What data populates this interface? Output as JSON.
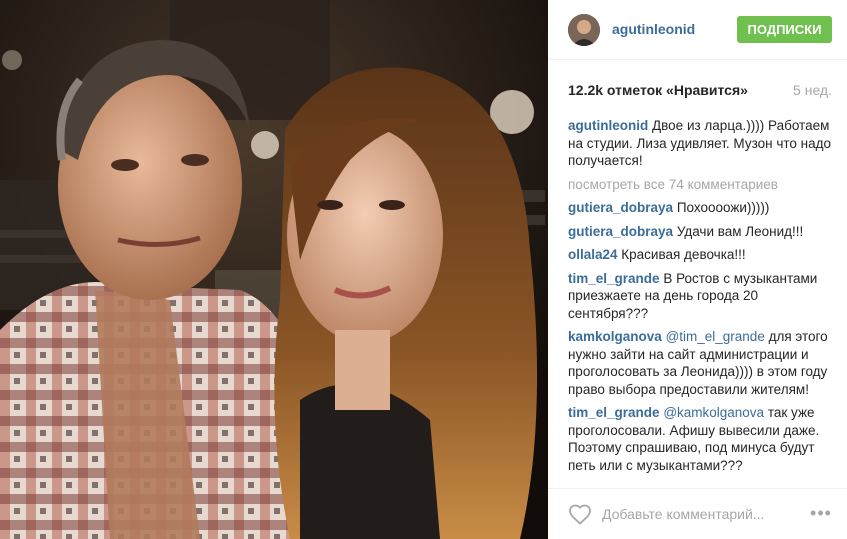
{
  "post": {
    "photo_alt": "Selfie of two people in a recording studio",
    "header": {
      "username": "agutinleonid",
      "follow_label": "ПОДПИСКИ"
    },
    "likes": "12.2k отметок «Нравится»",
    "time_ago": "5 нед.",
    "caption": {
      "user": "agutinleonid",
      "text": "Двое из ларца.)))) Работаем на студии. Лиза удивляет. Музон что надо получается!"
    },
    "view_all": "посмотреть все 74 комментариев",
    "comments": [
      {
        "user": "gutiera_dobraya",
        "text": "Похоооожи)))))"
      },
      {
        "user": "gutiera_dobraya",
        "text": "Удачи вам Леонид!!!"
      },
      {
        "user": "ollala24",
        "text": "Красивая девочка!!!"
      },
      {
        "user": "tim_el_grande",
        "text": "В Ростов с музыкантами приезжаете на день города 20 сентября???"
      },
      {
        "user": "kamkolganova",
        "mention": "@tim_el_grande",
        "text": "для этого нужно зайти на сайт администрации и проголосовать за Леонида)))) в этом году право выбора предоставили жителям!"
      },
      {
        "user": "tim_el_grande",
        "mention": "@kamkolganova",
        "text": "так уже проголосовали. Афишу вывесили даже. Поэтому спрашиваю, под минуса будут петь или с музыкантами???"
      }
    ],
    "comment_input": {
      "placeholder": "Добавьте комментарий..."
    },
    "icons": {
      "like": "heart-icon",
      "more": "more-options-icon"
    },
    "colors": {
      "follow_button": "#70c050",
      "username_link": "#3b6d99",
      "muted_text": "#a5a7aa"
    }
  }
}
